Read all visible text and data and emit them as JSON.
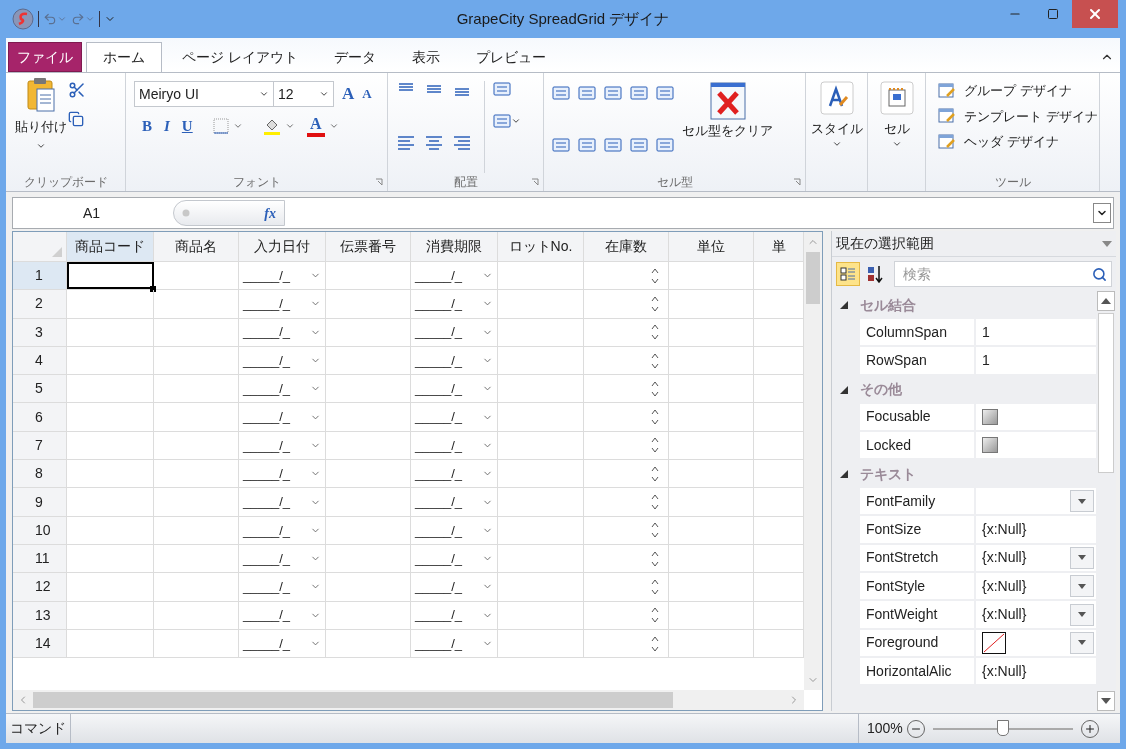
{
  "window": {
    "title": "GrapeCity SpreadGrid デザイナ"
  },
  "tabs": [
    {
      "label": "ファイル",
      "kind": "file",
      "selected": false
    },
    {
      "label": "ホーム",
      "kind": "tab",
      "selected": true
    },
    {
      "label": "ページ レイアウト",
      "kind": "tab",
      "selected": false
    },
    {
      "label": "データ",
      "kind": "tab",
      "selected": false
    },
    {
      "label": "表示",
      "kind": "tab",
      "selected": false
    },
    {
      "label": "プレビュー",
      "kind": "tab",
      "selected": false
    }
  ],
  "ribbon": {
    "clipboard": {
      "label": "クリップボード",
      "paste": "貼り付け"
    },
    "font": {
      "label": "フォント",
      "family": "Meiryo UI",
      "size": "12",
      "grow": "A",
      "shrink": "A",
      "bold": "B",
      "italic": "I",
      "underline": "U",
      "font_color_button": "A"
    },
    "alignment": {
      "label": "配置"
    },
    "cell_type": {
      "label": "セル型",
      "clear": "セル型をクリア"
    },
    "style": {
      "label": "スタイル"
    },
    "cell": {
      "label": "セル"
    },
    "tools": {
      "label": "ツール",
      "items": [
        "グループ デザイナ",
        "テンプレート デザイナ",
        "ヘッダ デザイナ"
      ]
    }
  },
  "formula_bar": {
    "name_box": "A1",
    "fx": "fx"
  },
  "grid": {
    "columns": [
      {
        "label": "商品コード",
        "kind": "text",
        "selected": true
      },
      {
        "label": "商品名",
        "kind": "text",
        "selected": false
      },
      {
        "label": "入力日付",
        "kind": "date",
        "selected": false
      },
      {
        "label": "伝票番号",
        "kind": "text",
        "selected": false
      },
      {
        "label": "消費期限",
        "kind": "date",
        "selected": false
      },
      {
        "label": "ロットNo.",
        "kind": "text",
        "selected": false
      },
      {
        "label": "在庫数",
        "kind": "number",
        "selected": false
      },
      {
        "label": "単位",
        "kind": "text",
        "selected": false
      },
      {
        "label": "単",
        "kind": "text",
        "selected": false
      }
    ],
    "rows": [
      {
        "header": "1",
        "selected": true,
        "entry_date": "_____/_",
        "expiry_date": "_____/_"
      },
      {
        "header": "2",
        "selected": false,
        "entry_date": "_____/_",
        "expiry_date": "_____/_"
      },
      {
        "header": "3",
        "selected": false,
        "entry_date": "_____/_",
        "expiry_date": "_____/_"
      },
      {
        "header": "4",
        "selected": false,
        "entry_date": "_____/_",
        "expiry_date": "_____/_"
      },
      {
        "header": "5",
        "selected": false,
        "entry_date": "_____/_",
        "expiry_date": "_____/_"
      },
      {
        "header": "6",
        "selected": false,
        "entry_date": "_____/_",
        "expiry_date": "_____/_"
      },
      {
        "header": "7",
        "selected": false,
        "entry_date": "_____/_",
        "expiry_date": "_____/_"
      },
      {
        "header": "8",
        "selected": false,
        "entry_date": "_____/_",
        "expiry_date": "_____/_"
      },
      {
        "header": "9",
        "selected": false,
        "entry_date": "_____/_",
        "expiry_date": "_____/_"
      },
      {
        "header": "10",
        "selected": false,
        "entry_date": "_____/_",
        "expiry_date": "_____/_"
      },
      {
        "header": "11",
        "selected": false,
        "entry_date": "_____/_",
        "expiry_date": "_____/_"
      },
      {
        "header": "12",
        "selected": false,
        "entry_date": "_____/_",
        "expiry_date": "_____/_"
      },
      {
        "header": "13",
        "selected": false,
        "entry_date": "_____/_",
        "expiry_date": "_____/_"
      },
      {
        "header": "14",
        "selected": false,
        "entry_date": "_____/_",
        "expiry_date": "_____/_"
      }
    ]
  },
  "properties": {
    "scope": "現在の選択範囲",
    "search": {
      "placeholder": "検索"
    },
    "categories": [
      {
        "label": "セル結合",
        "expanded": true,
        "items": [
          {
            "name": "ColumnSpan",
            "kind": "text",
            "value": "1"
          },
          {
            "name": "RowSpan",
            "kind": "text",
            "value": "1"
          }
        ]
      },
      {
        "label": "その他",
        "expanded": true,
        "items": [
          {
            "name": "Focusable",
            "kind": "checkbox",
            "checked": false
          },
          {
            "name": "Locked",
            "kind": "checkbox",
            "checked": false
          }
        ]
      },
      {
        "label": "テキスト",
        "expanded": true,
        "items": [
          {
            "name": "FontFamily",
            "kind": "dropdown"
          },
          {
            "name": "FontSize",
            "kind": "text",
            "value": "{x:Null}"
          },
          {
            "name": "FontStretch",
            "kind": "dropdown",
            "value": "{x:Null}"
          },
          {
            "name": "FontStyle",
            "kind": "dropdown",
            "value": "{x:Null}"
          },
          {
            "name": "FontWeight",
            "kind": "dropdown",
            "value": "{x:Null}"
          },
          {
            "name": "Foreground",
            "kind": "color"
          },
          {
            "name": "HorizontalAlic",
            "kind": "text",
            "value": "{x:Null}"
          }
        ]
      }
    ]
  },
  "status_bar": {
    "mode": "コマンド",
    "zoom": "100%",
    "zoom_slider": {
      "level": 0.5
    }
  }
}
